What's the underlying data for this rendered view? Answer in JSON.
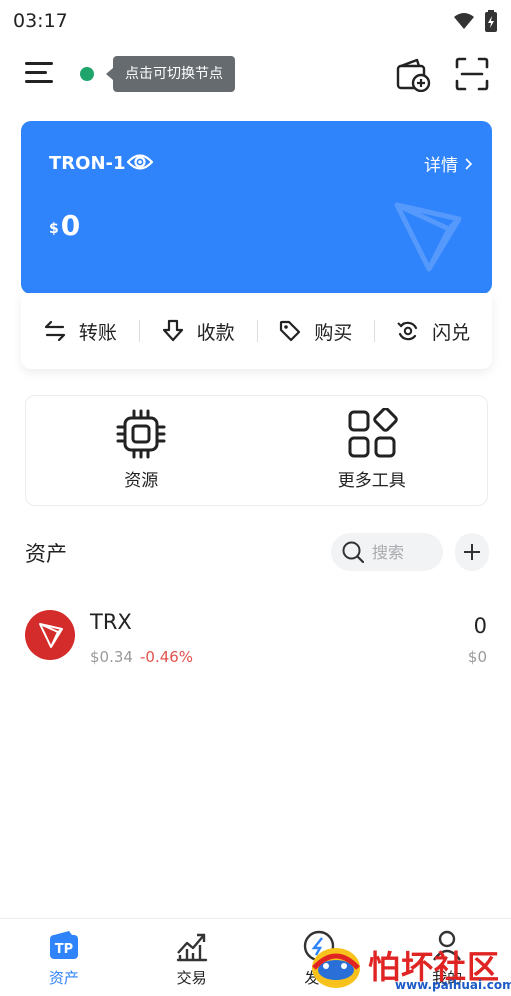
{
  "status_bar": {
    "time": "03:17"
  },
  "topbar": {
    "node_tooltip": "点击可切换节点"
  },
  "wallet": {
    "name": "TRON-1",
    "details_label": "详情",
    "currency_symbol": "$",
    "balance": "0"
  },
  "actions": [
    {
      "label": "转账",
      "icon": "transfer-icon"
    },
    {
      "label": "收款",
      "icon": "receive-icon"
    },
    {
      "label": "购买",
      "icon": "buy-tag-icon"
    },
    {
      "label": "闪兑",
      "icon": "swap-icon"
    }
  ],
  "tools": [
    {
      "label": "资源",
      "icon": "chip-icon"
    },
    {
      "label": "更多工具",
      "icon": "more-tools-icon"
    }
  ],
  "assets": {
    "title": "资产",
    "search_placeholder": "搜索",
    "tokens": [
      {
        "symbol": "TRX",
        "price": "$0.34",
        "change": "-0.46%",
        "amount": "0",
        "value": "$0"
      }
    ]
  },
  "bottom_nav": [
    {
      "label": "资产",
      "icon": "wallet-tp-icon",
      "active": true
    },
    {
      "label": "交易",
      "icon": "chart-icon",
      "active": false
    },
    {
      "label": "发现",
      "icon": "discover-icon",
      "active": false
    },
    {
      "label": "我的",
      "icon": "profile-icon",
      "active": false
    }
  ],
  "watermark": {
    "text": "怕坏社区",
    "url": "www.paihuai.com"
  },
  "colors": {
    "accent": "#2f83fb",
    "tron_red": "#d42b2b",
    "negative": "#e0524c",
    "online": "#1fa56b"
  }
}
